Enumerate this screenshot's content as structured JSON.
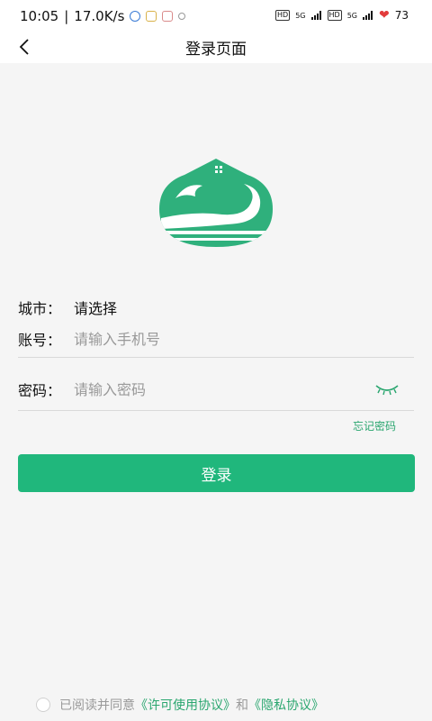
{
  "status_bar": {
    "time": "10:05",
    "network_speed": "17.0K/s",
    "hd1": "HD",
    "sig1": "5G",
    "hd2": "HD",
    "sig2": "5G",
    "battery": "73"
  },
  "header": {
    "title": "登录页面"
  },
  "form": {
    "city_label": "城市：",
    "city_value": "请选择",
    "account_label": "账号：",
    "account_placeholder": "请输入手机号",
    "password_label": "密码：",
    "password_placeholder": "请输入密码",
    "forgot_password": "忘记密码",
    "login_button": "登录"
  },
  "agreement": {
    "prefix": "已阅读并同意",
    "license_link": "《许可使用协议》",
    "and": "和",
    "privacy_link": "《隐私协议》"
  },
  "colors": {
    "accent": "#20b77c",
    "link": "#2aa66f"
  }
}
